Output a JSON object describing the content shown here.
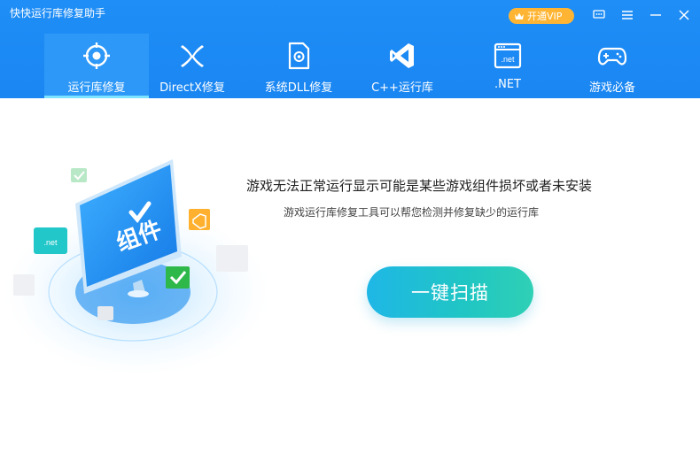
{
  "app": {
    "title": "快快运行库修复助手"
  },
  "header": {
    "vip_label": "开通VIP",
    "accent_color": "#1f8ef6"
  },
  "tabs": [
    {
      "label": "运行库修复",
      "icon": "target-icon",
      "active": true
    },
    {
      "label": "DirectX修复",
      "icon": "directx-icon",
      "active": false
    },
    {
      "label": "系统DLL修复",
      "icon": "dll-file-icon",
      "active": false
    },
    {
      "label": "C++运行库",
      "icon": "visual-studio-icon",
      "active": false
    },
    {
      "label": ".NET",
      "icon": "dotnet-window-icon",
      "active": false
    },
    {
      "label": "游戏必备",
      "icon": "gamepad-icon",
      "active": false
    }
  ],
  "main": {
    "title": "游戏无法正常运行显示可能是某些游戏组件损坏或者未安装",
    "subtitle": "游戏运行库修复工具可以帮您检测并修复缺少的运行库",
    "scan_button": "一键扫描",
    "illustration_text": "组件",
    "net_badge": ".net"
  }
}
